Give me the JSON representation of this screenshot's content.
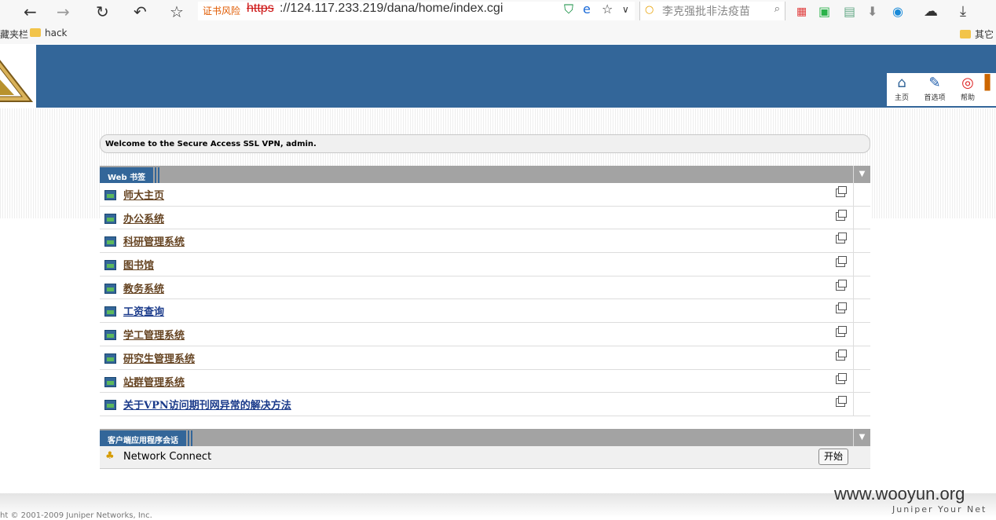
{
  "browser": {
    "cert_warning": "证书风险",
    "url_protocol": "https",
    "url_rest": "://124.117.233.219/dana/home/index.cgi",
    "search_placeholder": "李克强批非法疫苗",
    "bookmarks_bar": {
      "left_label": "藏夹栏",
      "hack_folder": "hack",
      "other_folder": "其它"
    }
  },
  "nav": {
    "home": "主页",
    "prefs": "首选项",
    "help": "帮助"
  },
  "welcome": "Welcome to the Secure Access SSL VPN, admin.",
  "web_bookmarks": {
    "title": "Web 书签",
    "items": [
      {
        "label": "师大主页"
      },
      {
        "label": "办公系统"
      },
      {
        "label": "科研管理系统"
      },
      {
        "label": "图书馆"
      },
      {
        "label": "教务系统"
      },
      {
        "label": "工资查询"
      },
      {
        "label": "学工管理系统"
      },
      {
        "label": "研究生管理系统"
      },
      {
        "label": "站群管理系统"
      },
      {
        "label": "关于VPN访问期刊网异常的解决方法"
      }
    ]
  },
  "client_apps": {
    "title": "客户端应用程序会话",
    "network_connect": "Network Connect",
    "start_label": "开始"
  },
  "footer": {
    "copyright": "ht © 2001-2009 Juniper Networks, Inc.",
    "watermark": "www.wooyun.org",
    "brand": "Juniper Your Net"
  }
}
